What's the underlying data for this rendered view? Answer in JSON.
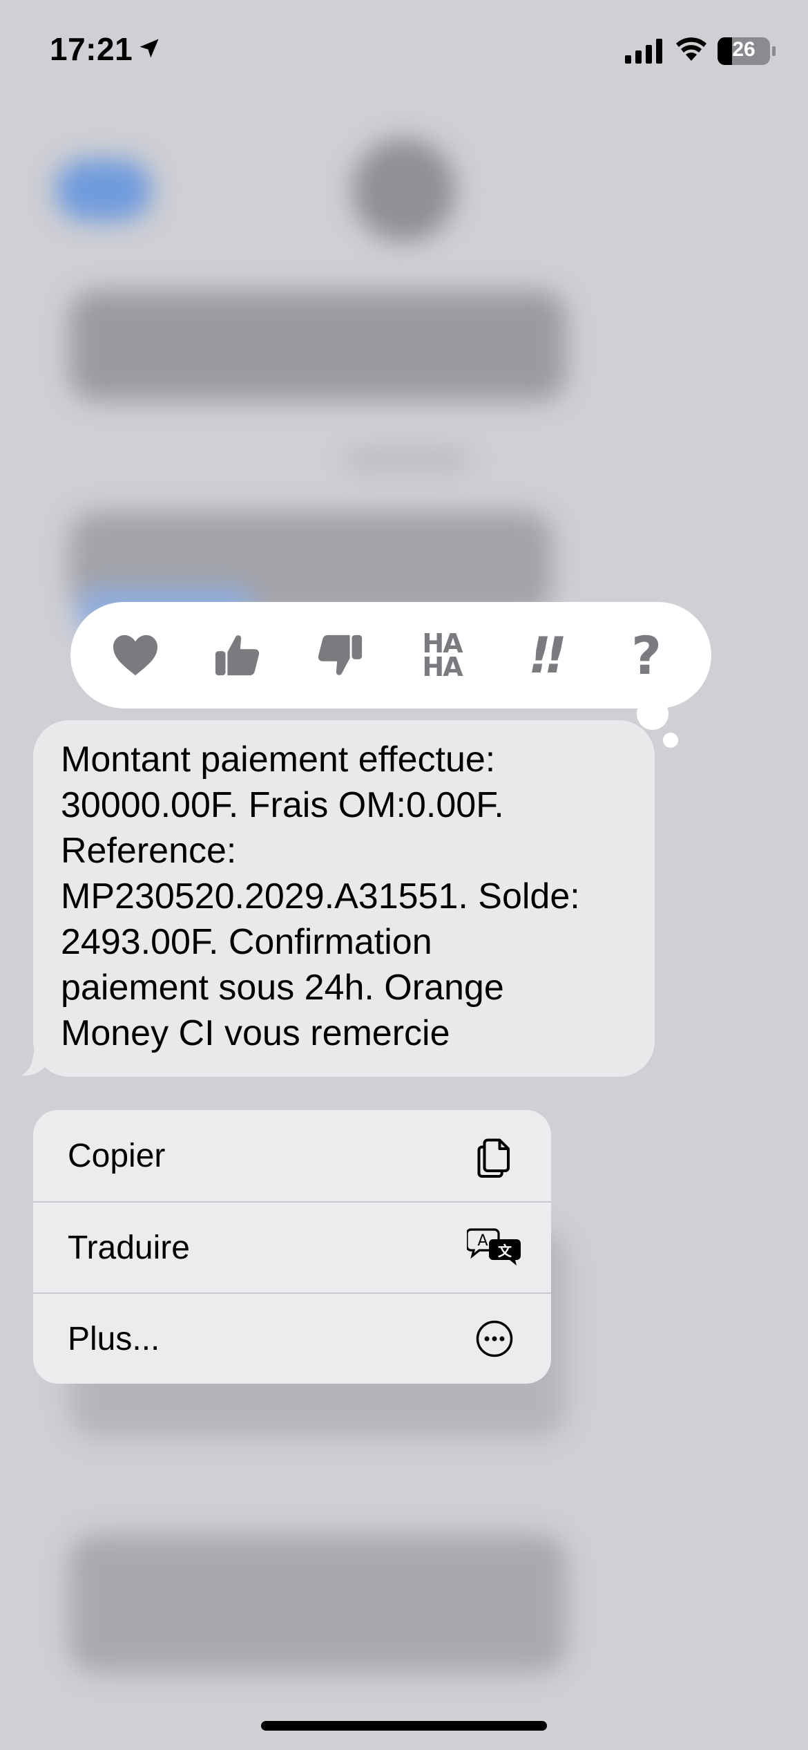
{
  "status_bar": {
    "time": "17:21",
    "battery_level": "26"
  },
  "reactions": [
    {
      "name": "heart"
    },
    {
      "name": "thumbs-up"
    },
    {
      "name": "thumbs-down"
    },
    {
      "name": "haha",
      "label_top": "HA",
      "label_bottom": "HA"
    },
    {
      "name": "emphasize",
      "label": "!!"
    },
    {
      "name": "question",
      "label": "?"
    }
  ],
  "message": {
    "text": "Montant paiement effectue:\n30000.00F. Frais OM:0.00F.\nReference:\nMP230520.2029.A31551. Solde:\n2493.00F. Confirmation\npaiement sous 24h. Orange\nMoney CI vous remercie"
  },
  "context_menu": {
    "items": [
      {
        "label": "Copier",
        "icon": "copy-icon"
      },
      {
        "label": "Traduire",
        "icon": "translate-icon"
      },
      {
        "label": "Plus...",
        "icon": "more-icon"
      }
    ]
  },
  "colors": {
    "background": "#cfcfd4",
    "bubble": "#e9e9eb",
    "menu": "#ececee",
    "reaction_icon": "#7b7b7f"
  }
}
